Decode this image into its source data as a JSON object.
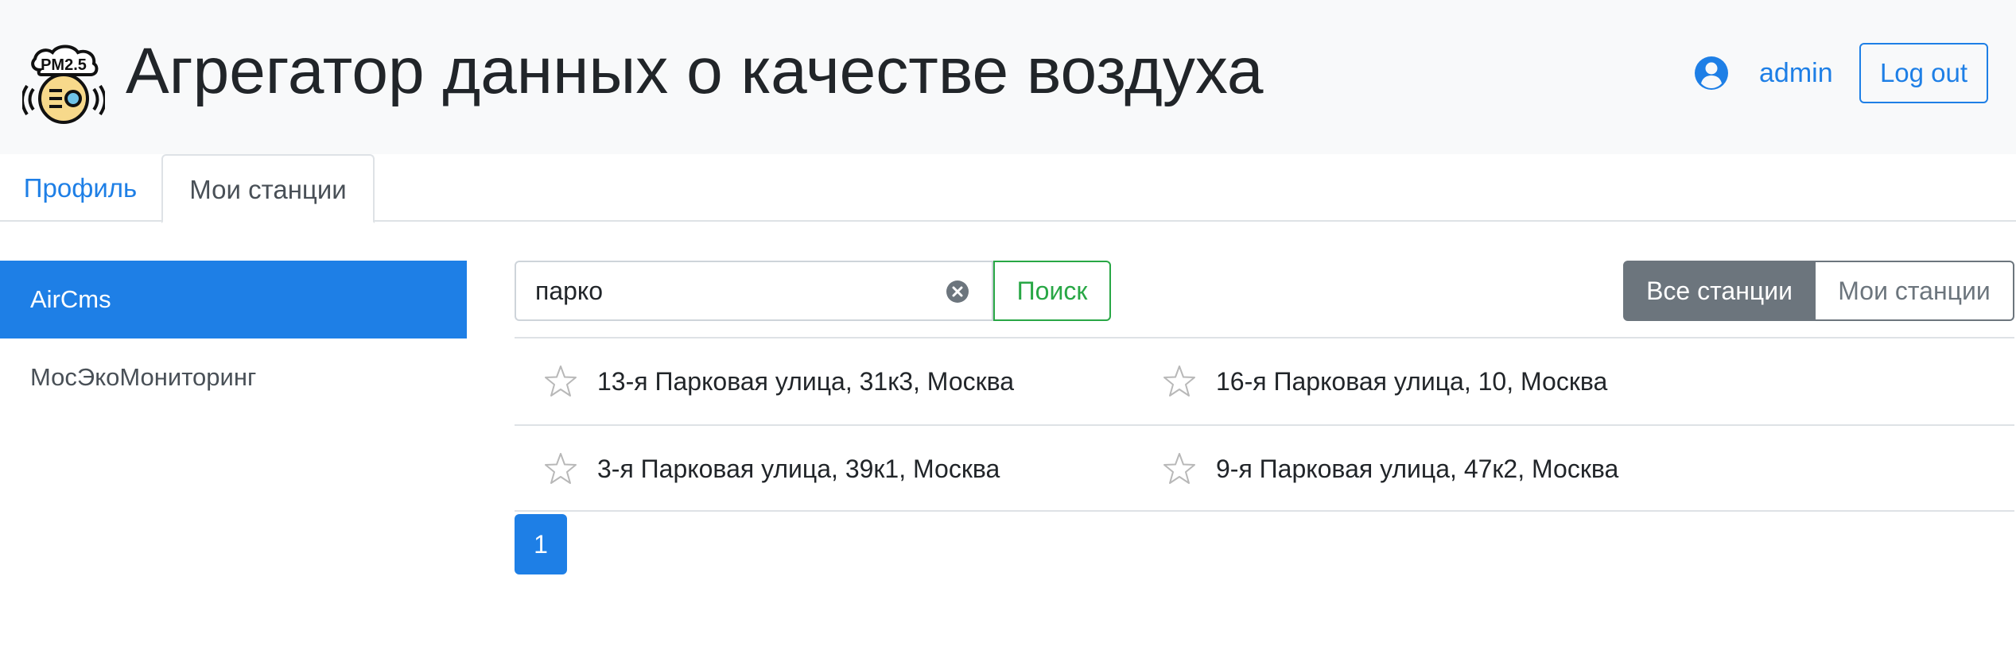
{
  "header": {
    "logo_text": "PM2.5",
    "title": "Агрегатор данных о качестве воздуха",
    "user_name": "admin",
    "logout_label": "Log out"
  },
  "tabs": [
    {
      "label": "Профиль",
      "active": false
    },
    {
      "label": "Мои станции",
      "active": true
    }
  ],
  "sidebar": {
    "items": [
      {
        "label": "AirCms",
        "active": true
      },
      {
        "label": "МосЭкоМониторинг",
        "active": false
      }
    ]
  },
  "search": {
    "value": "парко",
    "button_label": "Поиск"
  },
  "filter": {
    "all_label": "Все станции",
    "mine_label": "Мои станции",
    "selected": "Все станции"
  },
  "results": {
    "rows": [
      [
        "13-я Парковая улица, 31к3, Москва",
        "16-я Парковая улица, 10, Москва"
      ],
      [
        "3-я Парковая улица, 39к1, Москва",
        "9-я Парковая улица, 47к2, Москва"
      ]
    ]
  },
  "pagination": {
    "current_page": "1"
  },
  "icons": {
    "logo": "pm25-sensor-logo-icon",
    "user": "user-circle-icon",
    "clear": "clear-circle-x-icon",
    "favorite": "star-outline-icon"
  },
  "colors": {
    "primary": "#1e7fe6",
    "success": "#28a745",
    "secondary": "#6c757d",
    "header_bg": "#f8f9fa"
  }
}
